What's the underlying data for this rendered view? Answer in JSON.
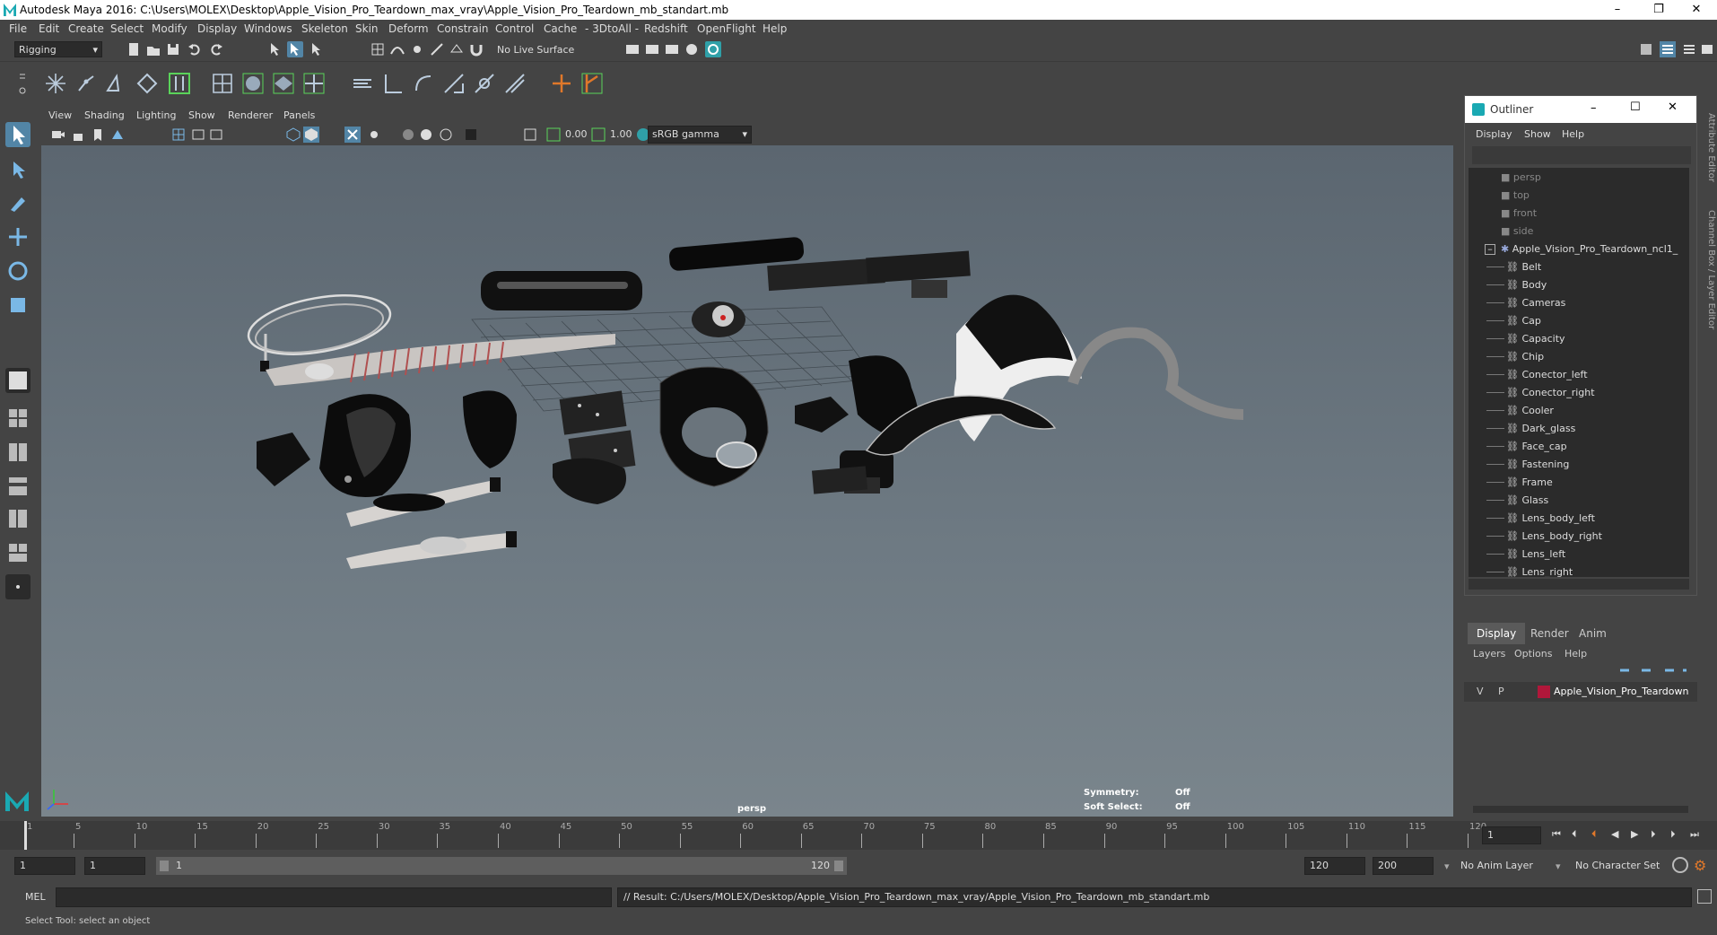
{
  "window": {
    "title": "Autodesk Maya 2016: C:\\Users\\MOLEX\\Desktop\\Apple_Vision_Pro_Teardown_max_vray\\Apple_Vision_Pro_Teardown_mb_standart.mb",
    "minimize": "–",
    "maximize": "❐",
    "close": "✕"
  },
  "menubar": [
    "File",
    "Edit",
    "Create",
    "Select",
    "Modify",
    "Display",
    "Windows",
    "Skeleton",
    "Skin",
    "Deform",
    "Constrain",
    "Control",
    "Cache",
    "- 3DtoAll -",
    "Redshift",
    "OpenFlight",
    "Help"
  ],
  "statusline": {
    "mode": "Rigging",
    "live_surface": "No Live Surface"
  },
  "panel": {
    "menus": [
      "View",
      "Shading",
      "Lighting",
      "Show",
      "Renderer",
      "Panels"
    ],
    "near": "0.00",
    "far": "1.00",
    "colorspace": "sRGB gamma"
  },
  "viewport": {
    "camera_label": "persp",
    "symmetry_label": "Symmetry:",
    "symmetry_value": "Off",
    "soft_select_label": "Soft Select:",
    "soft_select_value": "Off"
  },
  "timeline": {
    "ticks": [
      "1",
      "5",
      "10",
      "15",
      "20",
      "25",
      "30",
      "35",
      "40",
      "45",
      "50",
      "55",
      "60",
      "65",
      "70",
      "75",
      "80",
      "85",
      "90",
      "95",
      "100",
      "105",
      "110",
      "115",
      "120"
    ],
    "current_frame": "1"
  },
  "range": {
    "start": "1",
    "playback_start": "1",
    "slider_start": "1",
    "slider_end": "120",
    "playback_end": "120",
    "end": "200",
    "anim_layer": "No Anim Layer",
    "char_set": "No Character Set"
  },
  "command": {
    "lang": "MEL",
    "result": "// Result: C:/Users/MOLEX/Desktop/Apple_Vision_Pro_Teardown_max_vray/Apple_Vision_Pro_Teardown_mb_standart.mb"
  },
  "helpline": "Select Tool: select an object",
  "outliner": {
    "title": "Outliner",
    "menus": [
      "Display",
      "Show",
      "Help"
    ],
    "cameras": [
      "persp",
      "top",
      "front",
      "side"
    ],
    "root": "Apple_Vision_Pro_Teardown_ncl1_",
    "children": [
      "Belt",
      "Body",
      "Cameras",
      "Cap",
      "Capacity",
      "Chip",
      "Conector_left",
      "Conector_right",
      "Cooler",
      "Dark_glass",
      "Face_cap",
      "Fastening",
      "Frame",
      "Glass",
      "Lens_body_left",
      "Lens_body_right",
      "Lens_left",
      "Lens_right"
    ]
  },
  "layers": {
    "tabs": [
      "Display",
      "Render",
      "Anim"
    ],
    "menus": [
      "Layers",
      "Options",
      "Help"
    ],
    "layer_v": "V",
    "layer_p": "P",
    "layer_name": "Apple_Vision_Pro_Teardown",
    "layer_color": "#b0173a"
  },
  "sidetabs": [
    "Attribute Editor",
    "Channel Box / Layer Editor"
  ],
  "colors": {
    "accent": "#1aa9b3",
    "selected_tool": "#5285a6",
    "highlight_green": "#5ad35a",
    "highlight_orange": "#e0782a"
  }
}
